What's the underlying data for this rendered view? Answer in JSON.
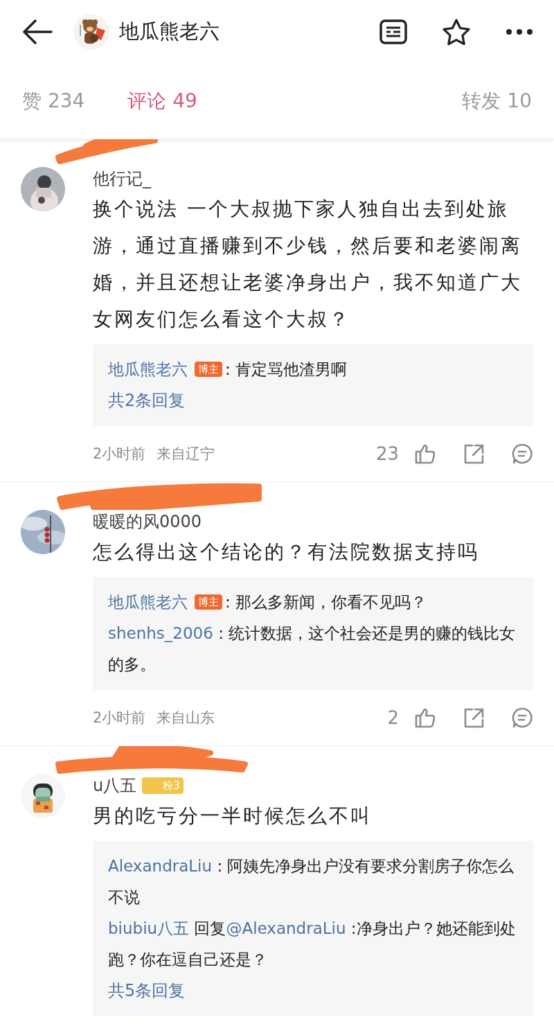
{
  "header": {
    "title": "地瓜熊老六"
  },
  "tabs": [
    {
      "label": "赞 234",
      "selected": false
    },
    {
      "label": "评论 49",
      "selected": true
    },
    {
      "label": "转发 10",
      "selected": false
    }
  ],
  "comments": [
    {
      "avatar": {
        "kind": "picture"
      },
      "username": "他行记_",
      "text": "换个说法 一个大叔抛下家人独自出去到处旅游，通过直播赚到不少钱，然后要和老婆闹离婚，并且还想让老婆净身出户，我不知道广大女网友们怎么看这个大叔？",
      "replies": [
        {
          "author": "地瓜熊老六",
          "badge": "博主",
          "text": ": 肯定骂他渣男啊"
        }
      ],
      "more": "共2条回复",
      "time": "2小时前",
      "location": "来自辽宁",
      "likes": "23"
    },
    {
      "avatar": {
        "kind": "picture"
      },
      "username": "暖暖的风0000",
      "text": "怎么得出这个结论的？有法院数据支持吗",
      "replies": [
        {
          "author": "地瓜熊老六",
          "badge": "博主",
          "text": ": 那么多新闻，你看不见吗？"
        },
        {
          "author": "shenhs_2006",
          "text": " : 统计数据，这个社会还是男的赚的钱比女的多。"
        }
      ],
      "time": "2小时前",
      "location": "来自山东",
      "likes": "2"
    },
    {
      "avatar": {
        "kind": "picture"
      },
      "username": "u八五",
      "fan_badge": "粉3",
      "text": "男的吃亏分一半时候怎么不叫",
      "replies": [
        {
          "author": "AlexandraLiu",
          "text": " : 阿姨先净身出户没有要求分割房子你怎么不说"
        },
        {
          "author": "biubiu八五",
          "reply_word": "回复",
          "mention": "@AlexandraLiu",
          "text": " :净身出户？她还能到处跑？你在逗自己还是？"
        }
      ],
      "more": "共5条回复"
    }
  ]
}
